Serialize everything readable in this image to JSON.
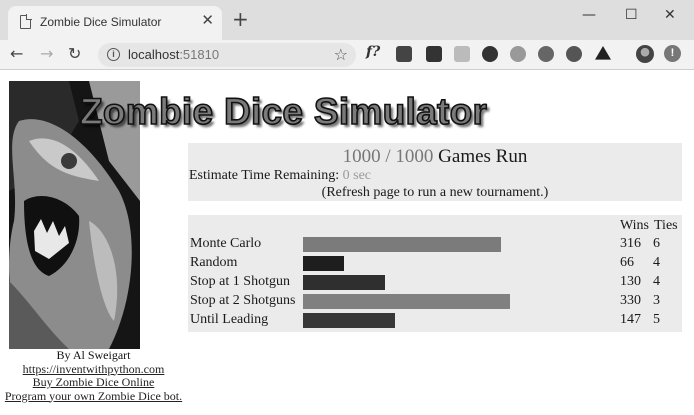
{
  "browser": {
    "tab_title": "Zombie Dice Simulator",
    "tab_close": "✕",
    "new_tab": "+",
    "window_controls": [
      "—",
      "☐",
      "✕"
    ],
    "url_host": "localhost",
    "url_port": ":51810",
    "extensions": [
      "f?",
      "translate-icon",
      "ublock-icon",
      "chat-icon",
      "play-icon",
      "cloud-icon",
      "grammar-icon",
      "wordpress-icon",
      "drive-icon"
    ]
  },
  "page": {
    "title": "Zombie Dice Simulator",
    "games_done": "1000 / 1000",
    "games_label": " Games Run",
    "estimate_label": "Estimate Time Remaining: ",
    "estimate_value": "0 sec",
    "refresh_note": "(Refresh page to run a new tournament.)",
    "credits": {
      "author": "By Al Sweigart",
      "links": [
        "https://inventwithpython.com",
        "Buy Zombie Dice Online",
        "Program your own Zombie Dice bot."
      ]
    }
  },
  "results": {
    "headers": {
      "wins": "Wins",
      "ties": "Ties"
    },
    "max_wins": 330,
    "bots": [
      {
        "name": "Monte Carlo",
        "wins": 316,
        "ties": 6,
        "color": "#7b7b7b"
      },
      {
        "name": "Random",
        "wins": 66,
        "ties": 4,
        "color": "#1e1e1e"
      },
      {
        "name": "Stop at 1 Shotgun",
        "wins": 130,
        "ties": 4,
        "color": "#2f2f2f"
      },
      {
        "name": "Stop at 2 Shotguns",
        "wins": 330,
        "ties": 3,
        "color": "#808080"
      },
      {
        "name": "Until Leading",
        "wins": 147,
        "ties": 5,
        "color": "#383838"
      }
    ]
  }
}
